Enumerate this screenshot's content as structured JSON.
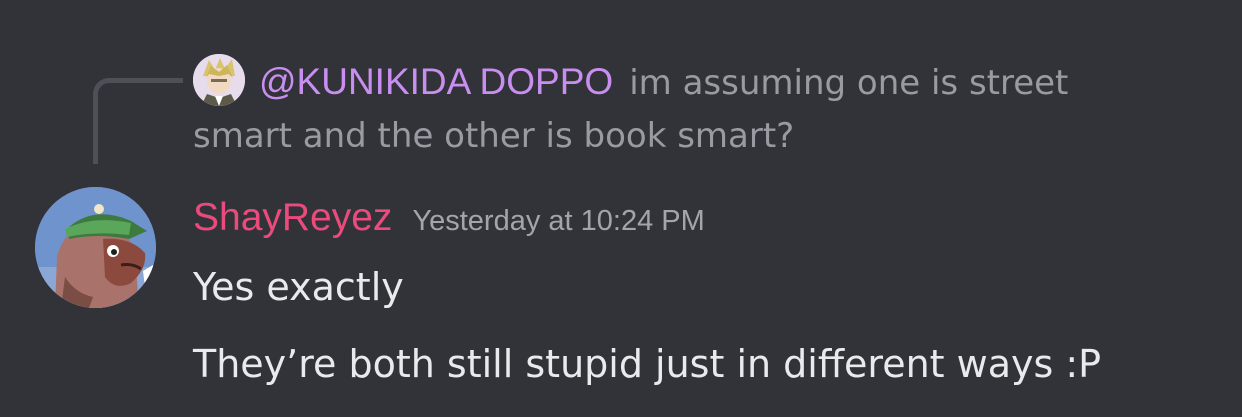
{
  "reply": {
    "author": "@KUNIKIDA DOPPO",
    "text_line1": "im assuming one is street",
    "text_line2": "smart and the other is book smart?"
  },
  "message": {
    "username": "ShayReyez",
    "timestamp": "Yesterday at 10:24 PM",
    "lines": [
      "Yes exactly",
      "They’re both still stupid just in different ways :P"
    ]
  },
  "colors": {
    "background": "#323338",
    "reply_author": "#c98ff0",
    "username": "#eb4a7c",
    "reply_text": "#9a9ba2",
    "message_text": "#e9eaee",
    "timestamp": "#a3a5ad"
  },
  "icons": {
    "reply_avatar": "anime-character-avatar",
    "main_avatar": "cartoon-character-avatar"
  }
}
